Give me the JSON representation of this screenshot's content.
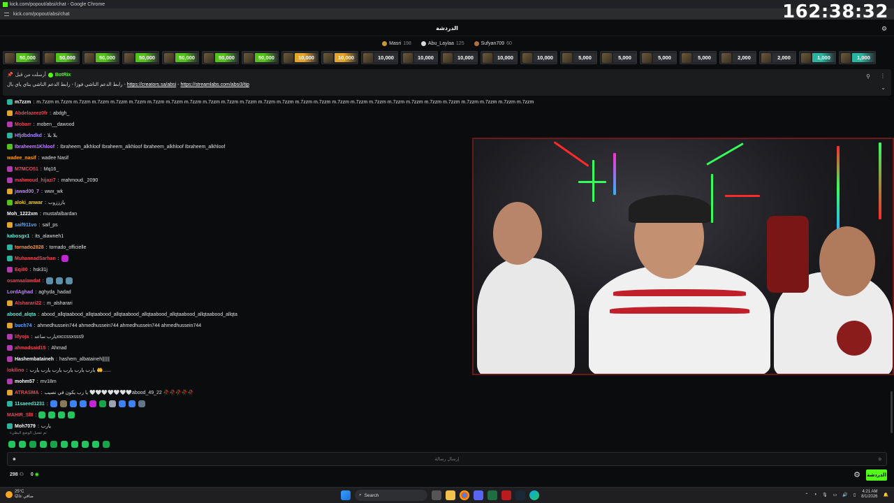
{
  "browser": {
    "window_title": "kick.com/popout/absi/chat - Google Chrome",
    "address": "kick.com/popout/absi/chat"
  },
  "stream_clock": "162:38:32",
  "header": {
    "title": "الدردشة"
  },
  "leaderboard": [
    {
      "name": "Masri",
      "points": "198",
      "tier": "gold"
    },
    {
      "name": "Abu_Laylaa",
      "points": "125",
      "tier": "silver"
    },
    {
      "name": "Sufyan709",
      "points": "60",
      "tier": "bronze"
    }
  ],
  "gifts": [
    {
      "amount": "50,000",
      "color": "#53c21a"
    },
    {
      "amount": "50,000",
      "color": "#53c21a"
    },
    {
      "amount": "50,000",
      "color": "#53c21a"
    },
    {
      "amount": "50,000",
      "color": "#53c21a"
    },
    {
      "amount": "50,000",
      "color": "#53c21a"
    },
    {
      "amount": "50,000",
      "color": "#53c21a"
    },
    {
      "amount": "50,000",
      "color": "#53c21a"
    },
    {
      "amount": "10,000",
      "color": "#e5a42a"
    },
    {
      "amount": "10,000",
      "color": "#e5a42a"
    },
    {
      "amount": "10,000",
      "color": "#2b2d31"
    },
    {
      "amount": "10,000",
      "color": "#2b2d31"
    },
    {
      "amount": "10,000",
      "color": "#2b2d31"
    },
    {
      "amount": "10,000",
      "color": "#2b2d31"
    },
    {
      "amount": "10,000",
      "color": "#2b2d31"
    },
    {
      "amount": "5,000",
      "color": "#2b2d31"
    },
    {
      "amount": "5,000",
      "color": "#2b2d31"
    },
    {
      "amount": "5,000",
      "color": "#2b2d31"
    },
    {
      "amount": "5,000",
      "color": "#2b2d31"
    },
    {
      "amount": "2,000",
      "color": "#2b2d31"
    },
    {
      "amount": "2,000",
      "color": "#2b2d31"
    },
    {
      "amount": "1,000",
      "color": "#2bb5a0"
    },
    {
      "amount": "1,000",
      "color": "#2bb5a0"
    }
  ],
  "pinned": {
    "pinned_by": "أرسلت من قبل",
    "bot": "BotRix",
    "line_prefix": "رابط الدعم الناشي فوزا - رابط الدعم الناشي بتاي ياي بال -",
    "link1": "https://creators.sa/absi",
    "separator": "-",
    "link2": "https://streamlabs.com/absi3/tip"
  },
  "messages": [
    {
      "user": "m7zzm",
      "text": "m.7zzm m.7zzm m.7zzm m.7zzm m.7zzm m.7zzm m.7zzm m.7zzm m.7zzm m.7zzm m.7zzm m.7zzm m.7zzm m.7zzm m.7zzm m.7zzm m.7zzm m.7zzm m.7zzm m.7zzm m.7zzm m.7zzm m.7zzm m.7zzm m.7zzm m.7zzm m.7zzm",
      "color": "#ffffff",
      "badge": "#2bb5a0"
    },
    {
      "user": "Abdelazeez0fr",
      "text": "abdgh_",
      "color": "#e34b5b",
      "badge": "#e5a42a"
    },
    {
      "user": "Mobarr",
      "text": "moben__dawood",
      "color": "#e34b5b",
      "badge": "#b33ab0"
    },
    {
      "user": "Hfjdbdndkd",
      "text": "بلا بلا",
      "color": "#a78bfa",
      "badge": "#2bb5a0"
    },
    {
      "user": "Ibraheem1Khloof",
      "text": "Ibraheem_alkhloof Ibraheem_alkhloof Ibraheem_alkhloof Ibraheem_alkhloof",
      "color": "#c084fc",
      "badge": "#53c21a"
    },
    {
      "user": "wadee_nasif",
      "text": "wadee Nasif",
      "color": "#f59e0b",
      "badge": ""
    },
    {
      "user": "M7MCO51",
      "text": "Mq16_",
      "color": "#e34b5b",
      "badge": "#b33ab0"
    },
    {
      "user": "mahmoud_hijazi7",
      "text": "mahmoud._2090",
      "color": "#e34b5b",
      "badge": "#b33ab0"
    },
    {
      "user": "jawad00_7",
      "text": "wwx_wk",
      "color": "#c084fc",
      "badge": "#e5a42a"
    },
    {
      "user": "aloki_anwar",
      "text": "يازززوب",
      "color": "#facc15",
      "badge": "#53c21a"
    },
    {
      "user": "Moh_1222xm",
      "text": "mustafalbardan",
      "color": "#ffffff",
      "badge": ""
    },
    {
      "user": "saif911vo",
      "text": "saif_ps",
      "color": "#60a5fa",
      "badge": "#e5a42a"
    },
    {
      "user": "kabosgx1",
      "text": "its_alawneh1",
      "color": "#5eead4",
      "badge": ""
    },
    {
      "user": "tornado2828",
      "text": "tornado_officielle",
      "color": "#fb923c",
      "badge": "#2bb5a0"
    },
    {
      "user": "MuhannadSarhan",
      "text": "",
      "color": "#e34b5b",
      "badge": "#2bb5a0",
      "emotes": [
        "#c026d3"
      ]
    },
    {
      "user": "Eqi80",
      "text": "hsk31j",
      "color": "#e34b5b",
      "badge": "#b33ab0"
    },
    {
      "user": "osamaalawdat",
      "text": "",
      "color": "#e34b5b",
      "badge": "",
      "emotes": [
        "#5b8fa8",
        "#5b8fa8",
        "#5b8fa8"
      ]
    },
    {
      "user": "LordAghad",
      "text": "aghyda_hadad",
      "color": "#c084fc",
      "badge": ""
    },
    {
      "user": "Alsharari22",
      "text": "m_alsharari",
      "color": "#e34b5b",
      "badge": "#e5a42a"
    },
    {
      "user": "abood_alqta",
      "text": "abood_allqtaabood_allqtaabood_allqtaabood_allqtaabood_allqtaabood_allqtaabood_allqta",
      "color": "#5eead4",
      "badge": ""
    },
    {
      "user": "buch74",
      "text": "ahmedhussein744 ahmedhussein744 ahmedhussein744 ahmedhussein744",
      "color": "#60a5fa",
      "badge": "#e5a42a"
    },
    {
      "user": "lifyoja",
      "text": "يارب ساعدxxccssxsss9",
      "color": "#e34b5b",
      "badge": "#b33ab0"
    },
    {
      "user": "ahmadsaid15",
      "text": "Ahmad",
      "color": "#e34b5b",
      "badge": "#b33ab0"
    },
    {
      "user": "Hashembataineh",
      "text": "hashem_albataineh||||||",
      "color": "#ffffff",
      "badge": "#b33ab0"
    },
    {
      "user": "lokilino",
      "text": "يارب يارب يارب يارب يارب يارب 🤲......",
      "color": "#e34b5b",
      "badge": ""
    },
    {
      "user": "mohm57",
      "text": "mv18m",
      "color": "#ffffff",
      "badge": "#b33ab0"
    },
    {
      "user": "ATRASMA",
      "text": "يا رب يكون في نصيب 🤍🤍🤍🤍🤍🤍🤍abood_49_22 🥀🥀🥀🥀🥀",
      "color": "#e34b5b",
      "badge": "#e5a42a"
    },
    {
      "user": "11saeed1231",
      "text": "",
      "color": "#5eead4",
      "badge": "#2bb5a0",
      "emotes": [
        "#3b82f6",
        "#8a7a5a",
        "#3b82f6",
        "#3b82f6",
        "#c026d3",
        "#16a34a",
        "#9ca3af",
        "#3b82f6",
        "#3b82f6",
        "#64748b"
      ]
    },
    {
      "user": "MAHIR_SlII",
      "text": "",
      "color": "#e34b5b",
      "badge": "",
      "emotes": [
        "#22c55e",
        "#22c55e",
        "#22c55e",
        "#22c55e"
      ]
    },
    {
      "user": "Moh7079",
      "text": "يارب",
      "color": "#ffffff",
      "badge": "#2bb5a0"
    }
  ],
  "suggestion_label": "تم تفعيل الوضع البطيء",
  "input": {
    "placeholder": "إرسال رسالة"
  },
  "footer": {
    "viewers": "298",
    "points": "0",
    "send_label": "الدردشة"
  },
  "taskbar": {
    "weather_temp": "25°C",
    "weather_text": "صافي غالبًا",
    "search_label": "Search",
    "time": "4:21 AM",
    "date": "8/1/2026"
  }
}
